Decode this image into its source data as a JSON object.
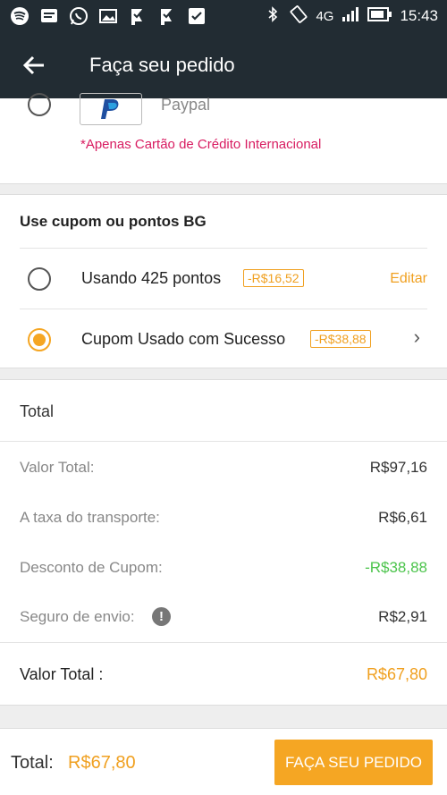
{
  "status_bar": {
    "icons_left": [
      "spotify-icon",
      "message-icon",
      "whatsapp-icon",
      "gallery-icon",
      "flag-icon",
      "flag-icon",
      "check-icon"
    ],
    "network": "4G",
    "time": "15:43"
  },
  "app_bar": {
    "title": "Faça seu pedido"
  },
  "payment": {
    "method_label": "Paypal",
    "note": "*Apenas Cartão de Crédito  Internacional"
  },
  "coupon": {
    "title": "Use cupom ou pontos BG",
    "points_label": "Usando 425 pontos",
    "points_badge": "-R$16,52",
    "points_action": "Editar",
    "coupon_label": "Cupom Usado com Sucesso",
    "coupon_badge": "-R$38,88"
  },
  "totals": {
    "header": "Total",
    "lines": [
      {
        "label": "Valor Total:",
        "value": "R$97,16"
      },
      {
        "label": "A taxa do transporte:",
        "value": "R$6,61"
      },
      {
        "label": "Desconto de Cupom:",
        "value": "-R$38,88"
      },
      {
        "label": "Seguro de envio:",
        "value": "R$2,91"
      }
    ],
    "grand_label": "Valor Total :",
    "grand_value": "R$67,80"
  },
  "bottom_bar": {
    "total_label": "Total:",
    "total_value": "R$67,80",
    "cta_label": "FAÇA SEU PEDIDO"
  },
  "colors": {
    "accent": "#f5a623",
    "appbar": "#222c33",
    "note": "#d81b60",
    "discount": "#4cc44c"
  }
}
